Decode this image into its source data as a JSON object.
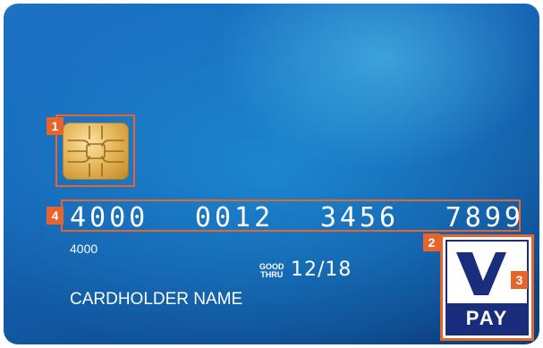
{
  "card": {
    "number_groups": [
      "4000",
      "0012",
      "3456",
      "7899"
    ],
    "small_number": "4000",
    "good_thru_line1": "GOOD",
    "good_thru_line2": "THRU",
    "expiry": "12/18",
    "cardholder": "CARDHOLDER NAME"
  },
  "callouts": {
    "chip": "1",
    "logo_area": "2",
    "logo_mark": "3",
    "number": "4"
  },
  "logo": {
    "mark": "V",
    "text": "PAY"
  },
  "colors": {
    "highlight": "#e8642a",
    "card_blue": "#1767b8",
    "vpay_navy": "#1a2d7c",
    "chip_gold": "#e6b85c"
  }
}
